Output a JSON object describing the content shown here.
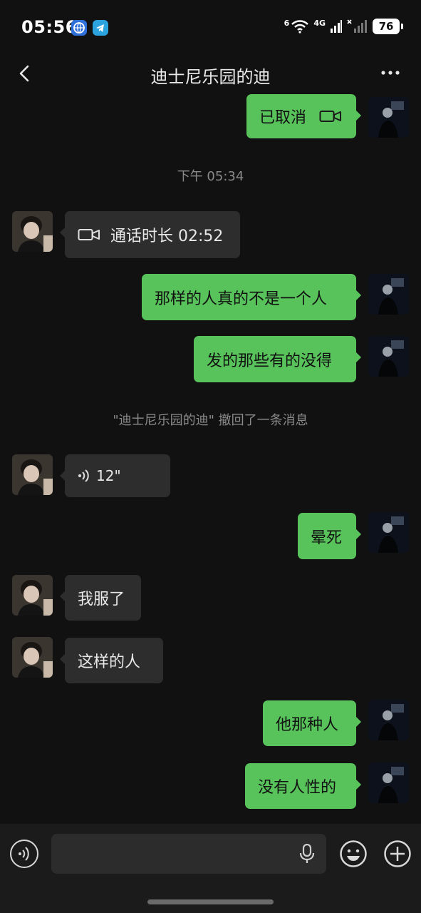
{
  "status_bar": {
    "time": "05:56",
    "network_4g": "4G",
    "network_6": "6",
    "battery": "76"
  },
  "header": {
    "title": "迪士尼乐园的迪"
  },
  "messages": [
    {
      "side": "right",
      "text": "已取消",
      "icon": "video-camera-icon"
    },
    {
      "type": "time",
      "text": "下午 05:34"
    },
    {
      "side": "left",
      "text": "通话时长 02:52",
      "icon": "video-camera-icon"
    },
    {
      "side": "right",
      "text": "那样的人真的不是一个人"
    },
    {
      "side": "right",
      "text": "发的那些有的没得"
    },
    {
      "type": "system",
      "text": "\"迪士尼乐园的迪\" 撤回了一条消息"
    },
    {
      "side": "left",
      "text": "12\"",
      "icon": "voice-wave-icon"
    },
    {
      "side": "right",
      "text": "晕死"
    },
    {
      "side": "left",
      "text": "我服了"
    },
    {
      "side": "left",
      "text": "这样的人"
    },
    {
      "side": "right",
      "text": "他那种人"
    },
    {
      "side": "right",
      "text": "没有人性的"
    }
  ],
  "input_bar": {
    "placeholder": ""
  },
  "colors": {
    "outgoing_bubble": "#58c35b",
    "incoming_bubble": "#2d2d2d",
    "background": "#111111"
  }
}
